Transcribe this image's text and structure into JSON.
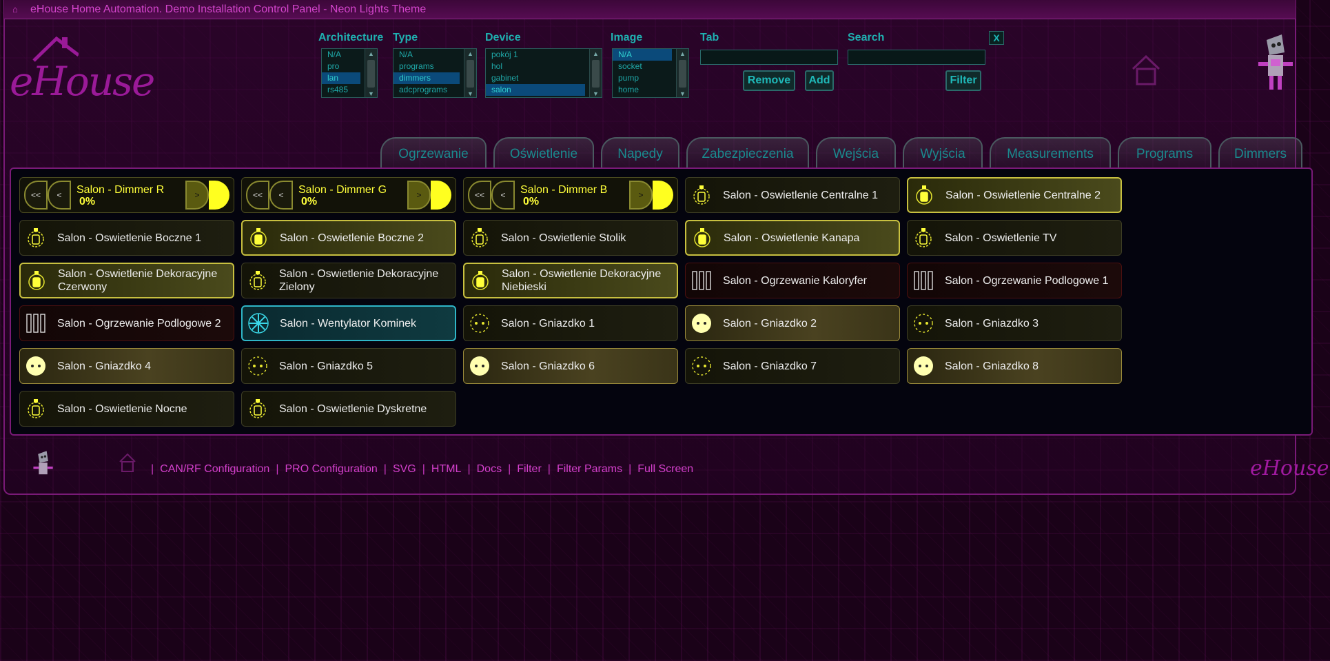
{
  "app": {
    "title": "eHouse Home Automation. Demo Installation Control Panel - Neon Lights Theme",
    "logo_text": "eHouse"
  },
  "filters": {
    "architecture": {
      "label": "Architecture",
      "options": [
        "N/A",
        "pro",
        "lan",
        "rs485"
      ],
      "selected": "lan"
    },
    "type": {
      "label": "Type",
      "options": [
        "N/A",
        "programs",
        "dimmers",
        "adcprograms"
      ],
      "selected": "dimmers"
    },
    "device": {
      "label": "Device",
      "options": [
        "pokój 1",
        "hol",
        "gabinet",
        "salon"
      ],
      "selected": "salon"
    },
    "image": {
      "label": "Image",
      "options": [
        "N/A",
        "socket",
        "pump",
        "home"
      ],
      "selected": "N/A"
    },
    "tab": {
      "label": "Tab",
      "value": ""
    },
    "search": {
      "label": "Search",
      "value": ""
    },
    "remove_label": "Remove",
    "add_label": "Add",
    "filter_label": "Filter",
    "close_label": "X"
  },
  "tabs": [
    "Ogrzewanie",
    "Oświetlenie",
    "Napedy",
    "Zabezpieczenia",
    "Wejścia",
    "Wyjścia",
    "Measurements",
    "Programs",
    "Dimmers"
  ],
  "dimmers": [
    {
      "name": "Salon - Dimmer R",
      "value": "0%",
      "btn_ll": "<<",
      "btn_l": "<",
      "btn_r": ">",
      "btn_rr": ">>"
    },
    {
      "name": "Salon - Dimmer G",
      "value": "0%",
      "btn_ll": "<<",
      "btn_l": "<",
      "btn_r": ">",
      "btn_rr": ">>"
    },
    {
      "name": "Salon - Dimmer B",
      "value": "0%",
      "btn_ll": "<<",
      "btn_l": "<",
      "btn_r": ">",
      "btn_rr": ">>"
    }
  ],
  "devices": [
    {
      "label": "Salon - Oswietlenie Centralne 1",
      "icon": "bulb",
      "state": "off"
    },
    {
      "label": "Salon - Oswietlenie Centralne 2",
      "icon": "bulb",
      "state": "on"
    },
    {
      "label": "Salon - Oswietlenie Boczne 1",
      "icon": "bulb",
      "state": "off"
    },
    {
      "label": "Salon - Oswietlenie Boczne 2",
      "icon": "bulb",
      "state": "on"
    },
    {
      "label": "Salon - Oswietlenie Stolik",
      "icon": "bulb",
      "state": "off"
    },
    {
      "label": "Salon - Oswietlenie Kanapa",
      "icon": "bulb",
      "state": "on"
    },
    {
      "label": "Salon - Oswietlenie TV",
      "icon": "bulb",
      "state": "off"
    },
    {
      "label": "Salon - Oswietlenie Dekoracyjne Czerwony",
      "icon": "bulb",
      "state": "on"
    },
    {
      "label": "Salon - Oswietlenie Dekoracyjne Zielony",
      "icon": "bulb",
      "state": "off"
    },
    {
      "label": "Salon - Oswietlenie Dekoracyjne Niebieski",
      "icon": "bulb",
      "state": "on"
    },
    {
      "label": "Salon - Ogrzewanie Kaloryfer",
      "icon": "radiator",
      "state": "heat"
    },
    {
      "label": "Salon - Ogrzewanie Podlogowe 1",
      "icon": "radiator",
      "state": "heat"
    },
    {
      "label": "Salon - Ogrzewanie Podlogowe 2",
      "icon": "radiator",
      "state": "heat"
    },
    {
      "label": "Salon - Wentylator Kominek",
      "icon": "fan",
      "state": "fan"
    },
    {
      "label": "Salon - Gniazdko 1",
      "icon": "socket",
      "state": "off"
    },
    {
      "label": "Salon - Gniazdko 2",
      "icon": "socket",
      "state": "sock-on"
    },
    {
      "label": "Salon - Gniazdko 3",
      "icon": "socket",
      "state": "off"
    },
    {
      "label": "Salon - Gniazdko 4",
      "icon": "socket",
      "state": "sock-on"
    },
    {
      "label": "Salon - Gniazdko 5",
      "icon": "socket",
      "state": "off"
    },
    {
      "label": "Salon - Gniazdko 6",
      "icon": "socket",
      "state": "sock-on"
    },
    {
      "label": "Salon - Gniazdko 7",
      "icon": "socket",
      "state": "off"
    },
    {
      "label": "Salon - Gniazdko 8",
      "icon": "socket",
      "state": "sock-on"
    },
    {
      "label": "Salon - Oswietlenie Nocne",
      "icon": "bulb",
      "state": "off"
    },
    {
      "label": "Salon - Oswietlenie Dyskretne",
      "icon": "bulb",
      "state": "off"
    }
  ],
  "footer": {
    "links": [
      "CAN/RF Configuration",
      "PRO Configuration",
      "SVG",
      "HTML",
      "Docs",
      "Filter",
      "Filter Params",
      "Full Screen"
    ],
    "sep": "|"
  },
  "colors": {
    "accent": "#d445cc",
    "teal": "#1fb0b0",
    "bulb_on": "#ffff3a"
  }
}
